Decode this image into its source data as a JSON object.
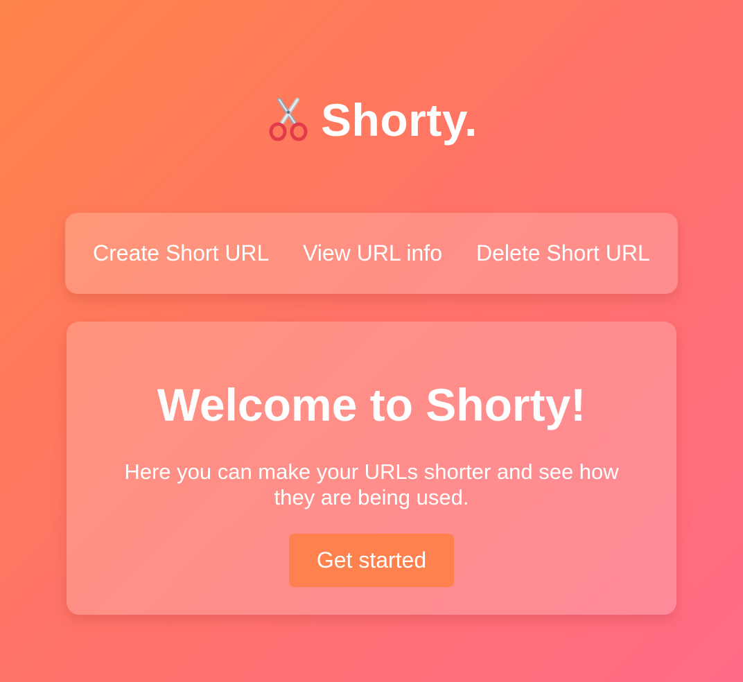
{
  "header": {
    "logo_icon": "scissors-icon",
    "title": "Shorty."
  },
  "nav": {
    "items": [
      {
        "label": "Create Short URL"
      },
      {
        "label": "View URL info"
      },
      {
        "label": "Delete Short URL"
      }
    ]
  },
  "welcome": {
    "heading": "Welcome to Shorty!",
    "description": "Here you can make your URLs shorter and see how they are being used.",
    "cta_label": "Get started"
  },
  "colors": {
    "background_start": "#ff8449",
    "background_end": "#ff6b86",
    "button": "#ff814e",
    "text": "#ffffff"
  }
}
